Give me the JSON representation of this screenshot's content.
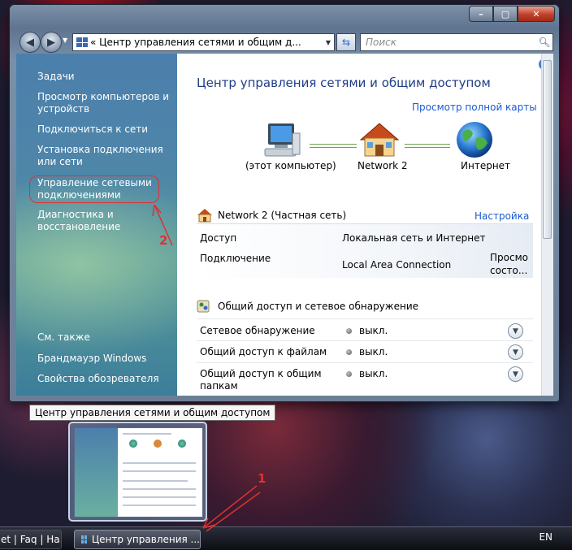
{
  "window": {
    "address": "«  Центр управления сетями и общим д...",
    "search_placeholder": "Поиск",
    "caption_min": "–",
    "caption_max": "▢",
    "caption_close": "✕"
  },
  "sidebar": {
    "items": [
      {
        "label": "Задачи"
      },
      {
        "label": "Просмотр компьютеров и устройств"
      },
      {
        "label": "Подключиться к сети"
      },
      {
        "label": "Установка подключения или сети"
      },
      {
        "label": "Управление сетевыми подключениями"
      },
      {
        "label": "Диагностика и восстановление"
      }
    ],
    "see_also": "См. также",
    "see_also_items": [
      {
        "label": "Брандмауэр Windows"
      },
      {
        "label": "Свойства обозревателя"
      }
    ]
  },
  "content": {
    "title": "Центр управления сетями и общим доступом",
    "full_map_link": "Просмотр полной карты",
    "map": {
      "computer": "(этот компьютер)",
      "network": "Network  2",
      "internet": "Интернет"
    },
    "network": {
      "name": "Network  2 (Частная сеть)",
      "customize": "Настройка",
      "access_label": "Доступ",
      "access_value": "Локальная сеть и Интернет",
      "connection_label": "Подключение",
      "connection_value": "Local Area Connection",
      "view_status_1": "Просмо",
      "view_status_2": "состо..."
    },
    "sharing": {
      "title": "Общий доступ и сетевое обнаружение",
      "rows": [
        {
          "label": "Сетевое обнаружение",
          "value": "выкл."
        },
        {
          "label": "Общий доступ к файлам",
          "value": "выкл."
        },
        {
          "label": "Общий доступ к общим папкам",
          "value": "выкл."
        }
      ]
    }
  },
  "tooltip": "Центр управления сетями и общим доступом",
  "taskbar": {
    "item1": "et | Faq | Ha...",
    "item2": "Центр управления ...",
    "lang": "EN"
  },
  "annotations": {
    "one": "1",
    "two": "2"
  }
}
